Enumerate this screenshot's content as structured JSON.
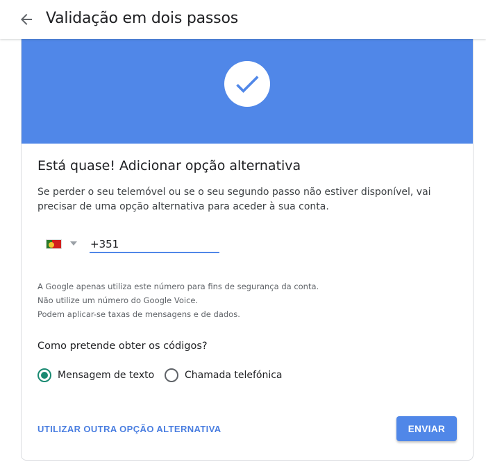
{
  "header": {
    "title": "Validação em dois passos",
    "back_icon": "arrow-left-icon"
  },
  "banner": {
    "color": "#5087e8",
    "icon": "checkmark-icon"
  },
  "content": {
    "heading": "Está quase! Adicionar opção alternativa",
    "description": "Se perder o seu telemóvel ou se o seu segundo passo não estiver disponível, vai precisar de uma opção alternativa para aceder à sua conta.",
    "phone": {
      "country_flag": "portugal-flag-icon",
      "value": "+351"
    },
    "notes": [
      "A Google apenas utiliza este número para fins de segurança da conta.",
      "Não utilize um número do Google Voice.",
      "Podem aplicar-se taxas de mensagens e de dados."
    ],
    "question": "Como pretende obter os códigos?",
    "options": [
      {
        "label": "Mensagem de texto",
        "selected": true
      },
      {
        "label": "Chamada telefónica",
        "selected": false
      }
    ]
  },
  "actions": {
    "alternative_link": "UTILIZAR OUTRA OPÇÃO ALTERNATIVA",
    "send_label": "ENVIAR"
  }
}
